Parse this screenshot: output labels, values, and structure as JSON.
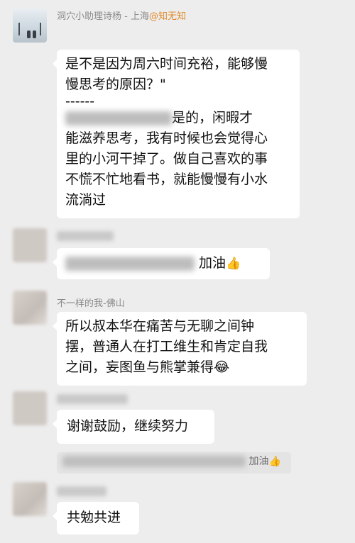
{
  "messages": {
    "m1": {
      "sender": "洞穴小助理诗杨 - 上海",
      "sender_tag": "@知无知",
      "line1": "是不是因为周六时间充裕，能够慢",
      "line2": "慢思考的原因？\"",
      "separator": "------",
      "line3_tail": "是的，闲暇才",
      "line4": "能滋养思考，我有时候也会觉得心",
      "line5": "里的小河干掉了。做自己喜欢的事",
      "line6": "不慌不忙地看书，就能慢慢有小水",
      "line7": "流淌过"
    },
    "m2": {
      "text": "加油",
      "emoji": "👍"
    },
    "m3": {
      "sender": "不一样的我-佛山",
      "line1": "所以叔本华在痛苦与无聊之间钟",
      "line2": "摆，普通人在打工维生和肯定自我",
      "line3": "之间，妄图鱼与熊掌兼得",
      "emoji": "😂"
    },
    "m4": {
      "text": "谢谢鼓励，继续努力"
    },
    "m4_quote": {
      "text": "加油",
      "emoji": "👍"
    },
    "m5": {
      "text": "共勉共进"
    }
  }
}
